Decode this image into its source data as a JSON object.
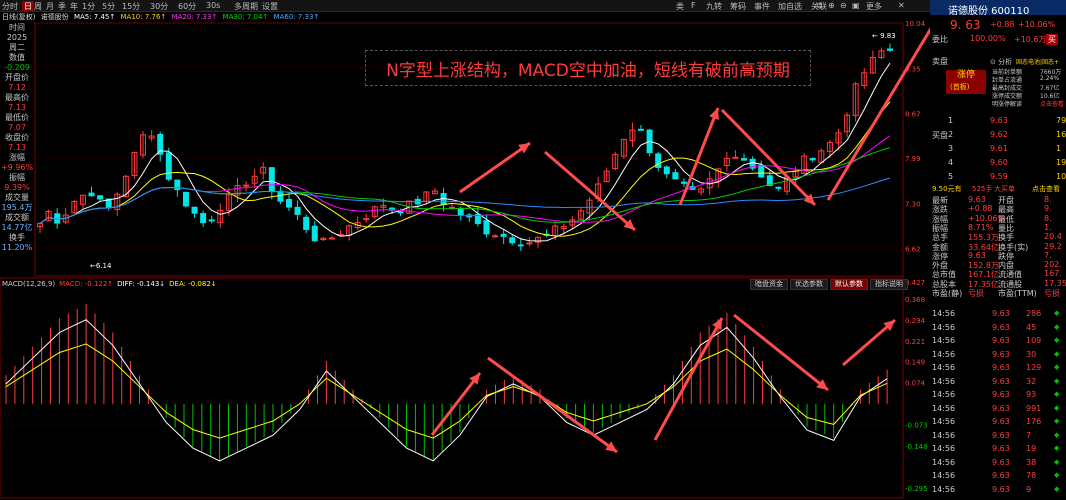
{
  "topbar": {
    "items": [
      "分时",
      "日",
      "周",
      "月",
      "季",
      "年",
      "1分",
      "5分",
      "15分",
      "30分",
      "60分",
      "30s",
      "多周期",
      "设置"
    ],
    "active_index": 1,
    "right_items": [
      "类",
      "F",
      "九转",
      "筹码",
      "事件",
      "加自选",
      "关联"
    ],
    "right_extra": "更多"
  },
  "infobar": {
    "period": "日线(复权)",
    "name": "诺德股份",
    "ma5": "MA5: 7.45↑",
    "ma10": "MA10: 7.76↑",
    "ma20": "MA20: 7.33↑",
    "ma30": "MA30: 7.04↑",
    "ma60": "MA60: 7.33↑"
  },
  "sidebar": [
    {
      "label": "时间",
      "value": "2025"
    },
    {
      "label": "周二",
      "value": "数值"
    },
    {
      "label": "",
      "value": "-0.209"
    },
    {
      "label": "开盘价",
      "value": "7.12"
    },
    {
      "label": "最高价",
      "value": "7.13"
    },
    {
      "label": "最低价",
      "value": "7.07"
    },
    {
      "label": "收盘价",
      "value": "7.13"
    },
    {
      "label": "涨幅",
      "value": "+9.96%"
    },
    {
      "label": "振幅",
      "value": "9.39%"
    },
    {
      "label": "成交量",
      "value": "195.4万"
    },
    {
      "label": "成交额",
      "value": "14.77亿"
    },
    {
      "label": "换手",
      "value": "11.20%"
    }
  ],
  "annotation": "N字型上涨结构，MACD空中加油，短线有破前高预期",
  "price_axis": [
    "10.04",
    "9.35",
    "8.67",
    "7.99",
    "7.30",
    "6.62"
  ],
  "price_markers": {
    "high": "9.83",
    "low": "6.14"
  },
  "macd": {
    "title": "MACD(12,26,9)",
    "macd": "MACD: -0.122↑",
    "diff": "DIFF: -0.143↓",
    "dea": "DEA: -0.082↓",
    "axis": [
      "0.427",
      "0.368",
      "0.294",
      "0.221",
      "0.149",
      "0.074",
      "-0.073",
      "-0.148",
      "-0.295"
    ]
  },
  "macd_buttons": [
    "暗盘资金",
    "优选参数",
    "默认参数",
    "指标说明"
  ],
  "quote": {
    "name": "诺德股份",
    "code": "600110",
    "price": "9. 63",
    "change": "+0.88",
    "pct": "+10.06%",
    "committee": "委比",
    "committee_val": "100.00%",
    "committee_diff": "+10.6万",
    "buy_tag": "买",
    "sell_tag": "卖",
    "limit": "涨停",
    "limit_sub": "(首板)",
    "analysis_title": "分析",
    "analysis_tag": "固态电池|固态+",
    "analysis": [
      {
        "k": "当前封单额",
        "v": "7660万"
      },
      {
        "k": "封单占流通",
        "v": "2.24%"
      },
      {
        "k": "最高封成交",
        "v": "7.67亿"
      },
      {
        "k": "涨停成交额",
        "v": "10.6亿"
      },
      {
        "k": "明涨停解读",
        "v": "点击查看"
      }
    ]
  },
  "sell_label": "卖盘",
  "buy_label": "买盘",
  "order_book": [
    {
      "n": "1",
      "p": "9.63",
      "v": "795"
    },
    {
      "n": "2",
      "p": "9.62",
      "v": "16"
    },
    {
      "n": "3",
      "p": "9.61",
      "v": "1"
    },
    {
      "n": "4",
      "p": "9.60",
      "v": "19"
    },
    {
      "n": "5",
      "p": "9.59",
      "v": "10"
    }
  ],
  "big_order": {
    "left": "9.50元有",
    "mid": "525手",
    "right": "大买单",
    "link": "点击查看"
  },
  "stats": [
    {
      "k": "最新",
      "v": "9.63",
      "k2": "开盘",
      "v2": "8."
    },
    {
      "k": "涨跌",
      "v": "+0.88",
      "k2": "最高",
      "v2": "9."
    },
    {
      "k": "涨幅",
      "v": "+10.06%",
      "k2": "最低",
      "v2": "8."
    },
    {
      "k": "振幅",
      "v": "8.71%",
      "k2": "量比",
      "v2": "1."
    },
    {
      "k": "总手",
      "v": "155.3万",
      "k2": "换手",
      "v2": "20.4"
    },
    {
      "k": "金额",
      "v": "33.64亿",
      "k2": "换手(实)",
      "v2": "29.2"
    },
    {
      "k": "涨停",
      "v": "9.63",
      "k2": "跌停",
      "v2": "7."
    },
    {
      "k": "外盘",
      "v": "152.8万",
      "k2": "内盘",
      "v2": "202."
    },
    {
      "k": "总市值",
      "v": "167.1亿",
      "k2": "流通值",
      "v2": "167."
    },
    {
      "k": "总股本",
      "v": "17.35亿",
      "k2": "流通股",
      "v2": "17.35"
    },
    {
      "k": "市盈(静)",
      "v": "亏损",
      "k2": "市盈(TTM)",
      "v2": "亏损"
    }
  ],
  "ticks": [
    {
      "t": "14:56",
      "p": "9.63",
      "v": "286"
    },
    {
      "t": "14:56",
      "p": "9.63",
      "v": "45"
    },
    {
      "t": "14:56",
      "p": "9.63",
      "v": "109"
    },
    {
      "t": "14:56",
      "p": "9.63",
      "v": "30"
    },
    {
      "t": "14:56",
      "p": "9.63",
      "v": "129"
    },
    {
      "t": "14:56",
      "p": "9.63",
      "v": "32"
    },
    {
      "t": "14:56",
      "p": "9.63",
      "v": "93"
    },
    {
      "t": "14:56",
      "p": "9.63",
      "v": "991"
    },
    {
      "t": "14:56",
      "p": "9.63",
      "v": "176"
    },
    {
      "t": "14:56",
      "p": "9.63",
      "v": "7"
    },
    {
      "t": "14:56",
      "p": "9.63",
      "v": "19"
    },
    {
      "t": "14:56",
      "p": "9.63",
      "v": "38"
    },
    {
      "t": "14:56",
      "p": "9.63",
      "v": "78"
    },
    {
      "t": "14:56",
      "p": "9.63",
      "v": "9"
    }
  ],
  "colors": {
    "up": "#ff3c3c",
    "down": "#00e5e5",
    "green": "#00c000",
    "yellow": "#ffff00",
    "white": "#ffffff",
    "magenta": "#ff00ff",
    "arrow": "#ff4b4b"
  }
}
